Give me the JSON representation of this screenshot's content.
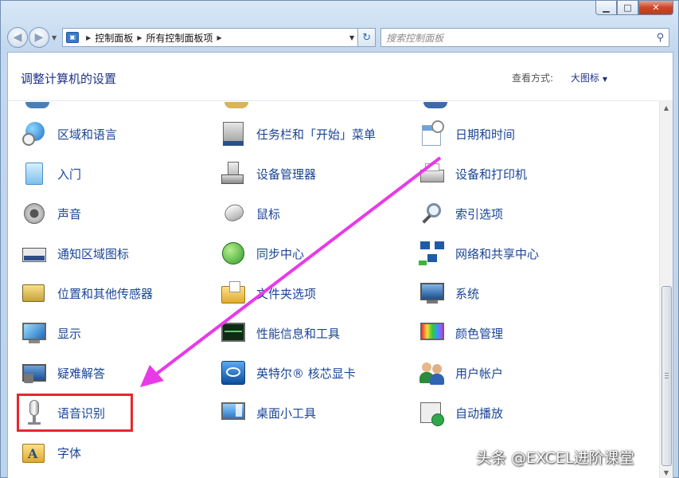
{
  "window": {
    "minimize": "▁",
    "maximize": "□",
    "close": "✕"
  },
  "nav": {
    "back_icon": "back-arrow-icon",
    "forward_icon": "forward-arrow-icon",
    "breadcrumbs": [
      "控制面板",
      "所有控制面板项"
    ],
    "search_placeholder": "搜索控制面板"
  },
  "header": {
    "title": "调整计算机的设置",
    "view_by_label": "查看方式:",
    "view_by_value": "大图标"
  },
  "items": [
    {
      "label": "区域和语言",
      "icon": "globe-clock-icon"
    },
    {
      "label": "任务栏和「开始」菜单",
      "icon": "taskbar-icon"
    },
    {
      "label": "日期和时间",
      "icon": "calendar-clock-icon"
    },
    {
      "label": "入门",
      "icon": "getting-started-icon"
    },
    {
      "label": "设备管理器",
      "icon": "device-manager-icon"
    },
    {
      "label": "设备和打印机",
      "icon": "printer-icon"
    },
    {
      "label": "声音",
      "icon": "speaker-icon"
    },
    {
      "label": "鼠标",
      "icon": "mouse-icon"
    },
    {
      "label": "索引选项",
      "icon": "magnifier-icon"
    },
    {
      "label": "通知区域图标",
      "icon": "notification-area-icon"
    },
    {
      "label": "同步中心",
      "icon": "sync-icon"
    },
    {
      "label": "网络和共享中心",
      "icon": "network-icon"
    },
    {
      "label": "位置和其他传感器",
      "icon": "location-sensor-icon"
    },
    {
      "label": "文件夹选项",
      "icon": "folder-options-icon"
    },
    {
      "label": "系统",
      "icon": "system-icon"
    },
    {
      "label": "显示",
      "icon": "display-icon"
    },
    {
      "label": "性能信息和工具",
      "icon": "performance-icon"
    },
    {
      "label": "颜色管理",
      "icon": "color-management-icon"
    },
    {
      "label": "疑难解答",
      "icon": "troubleshooting-icon"
    },
    {
      "label": "英特尔® 核芯显卡",
      "icon": "intel-graphics-icon"
    },
    {
      "label": "用户帐户",
      "icon": "user-accounts-icon"
    },
    {
      "label": "语音识别",
      "icon": "microphone-icon"
    },
    {
      "label": "桌面小工具",
      "icon": "gadgets-icon"
    },
    {
      "label": "自动播放",
      "icon": "autoplay-icon"
    },
    {
      "label": "字体",
      "icon": "fonts-icon"
    }
  ],
  "colors": {
    "link": "#1a4496",
    "title": "#1e3287",
    "highlight": "#e8262d",
    "arrow": "#e83ae8"
  },
  "watermark": "头条 @EXCEL进阶课堂"
}
